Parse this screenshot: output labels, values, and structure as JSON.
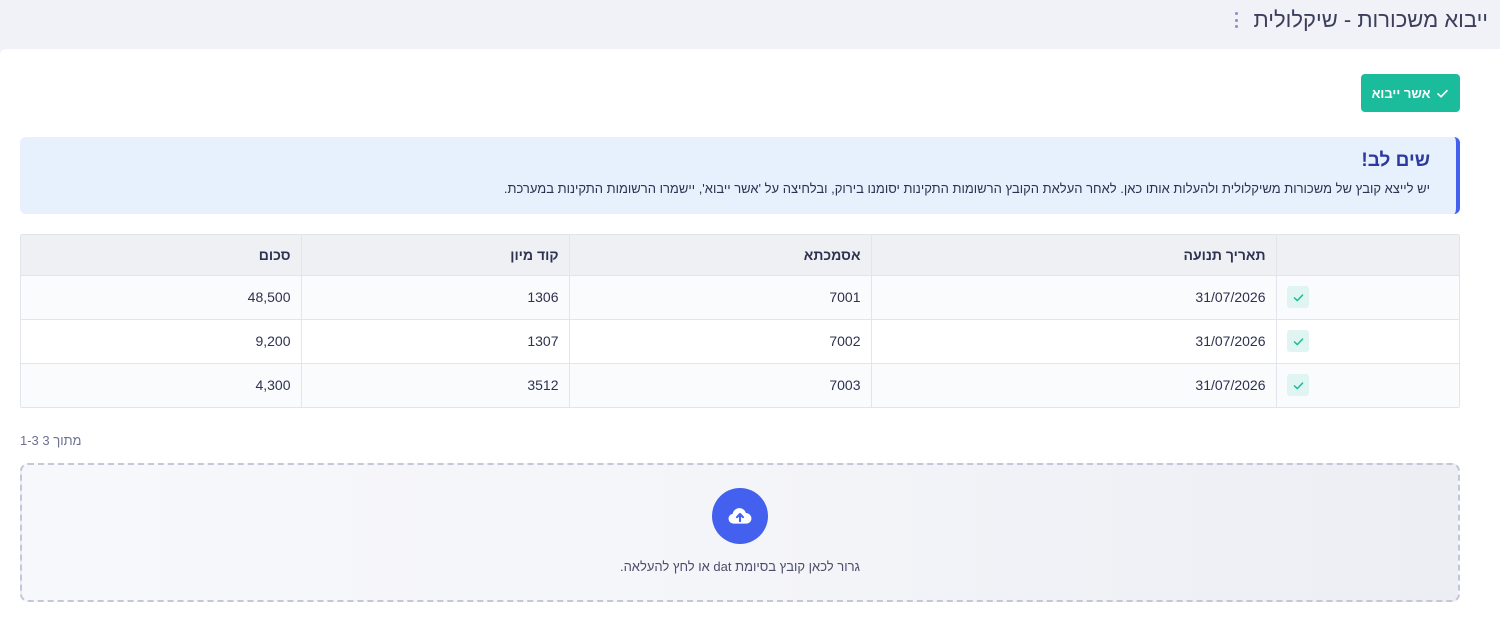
{
  "header": {
    "title": "ייבוא משכורות - שיקלולית",
    "menu_icon": "vertical-dots-icon"
  },
  "toolbar": {
    "confirm_label": "אשר ייבוא",
    "confirm_icon": "check-icon"
  },
  "alert": {
    "title": "שים לב!",
    "body": "יש לייצא קובץ של משכורות משיקלולית ולהעלות אותו כאן. לאחר העלאת הקובץ הרשומות התקינות יסומנו בירוק, ובלחיצה על 'אשר ייבוא', יישמרו הרשומות התקינות במערכת."
  },
  "table": {
    "columns": [
      "",
      "תאריך תנועה",
      "אסמכתא",
      "קוד מיון",
      "סכום"
    ],
    "rows": [
      {
        "status": "valid",
        "date": "31/07/2026",
        "reference": "7001",
        "sort_code": "1306",
        "amount": "48,500"
      },
      {
        "status": "valid",
        "date": "31/07/2026",
        "reference": "7002",
        "sort_code": "1307",
        "amount": "9,200"
      },
      {
        "status": "valid",
        "date": "31/07/2026",
        "reference": "7003",
        "sort_code": "3512",
        "amount": "4,300"
      }
    ]
  },
  "pagination": {
    "text": "1-3 מתוך 3"
  },
  "dropzone": {
    "icon": "cloud-upload-icon",
    "text": "גרור לכאן קובץ בסיומת dat או לחץ להעלאה."
  },
  "colors": {
    "accent": "#4361ee",
    "success": "#1abc9c",
    "alert_bg": "#e7f0fd"
  }
}
